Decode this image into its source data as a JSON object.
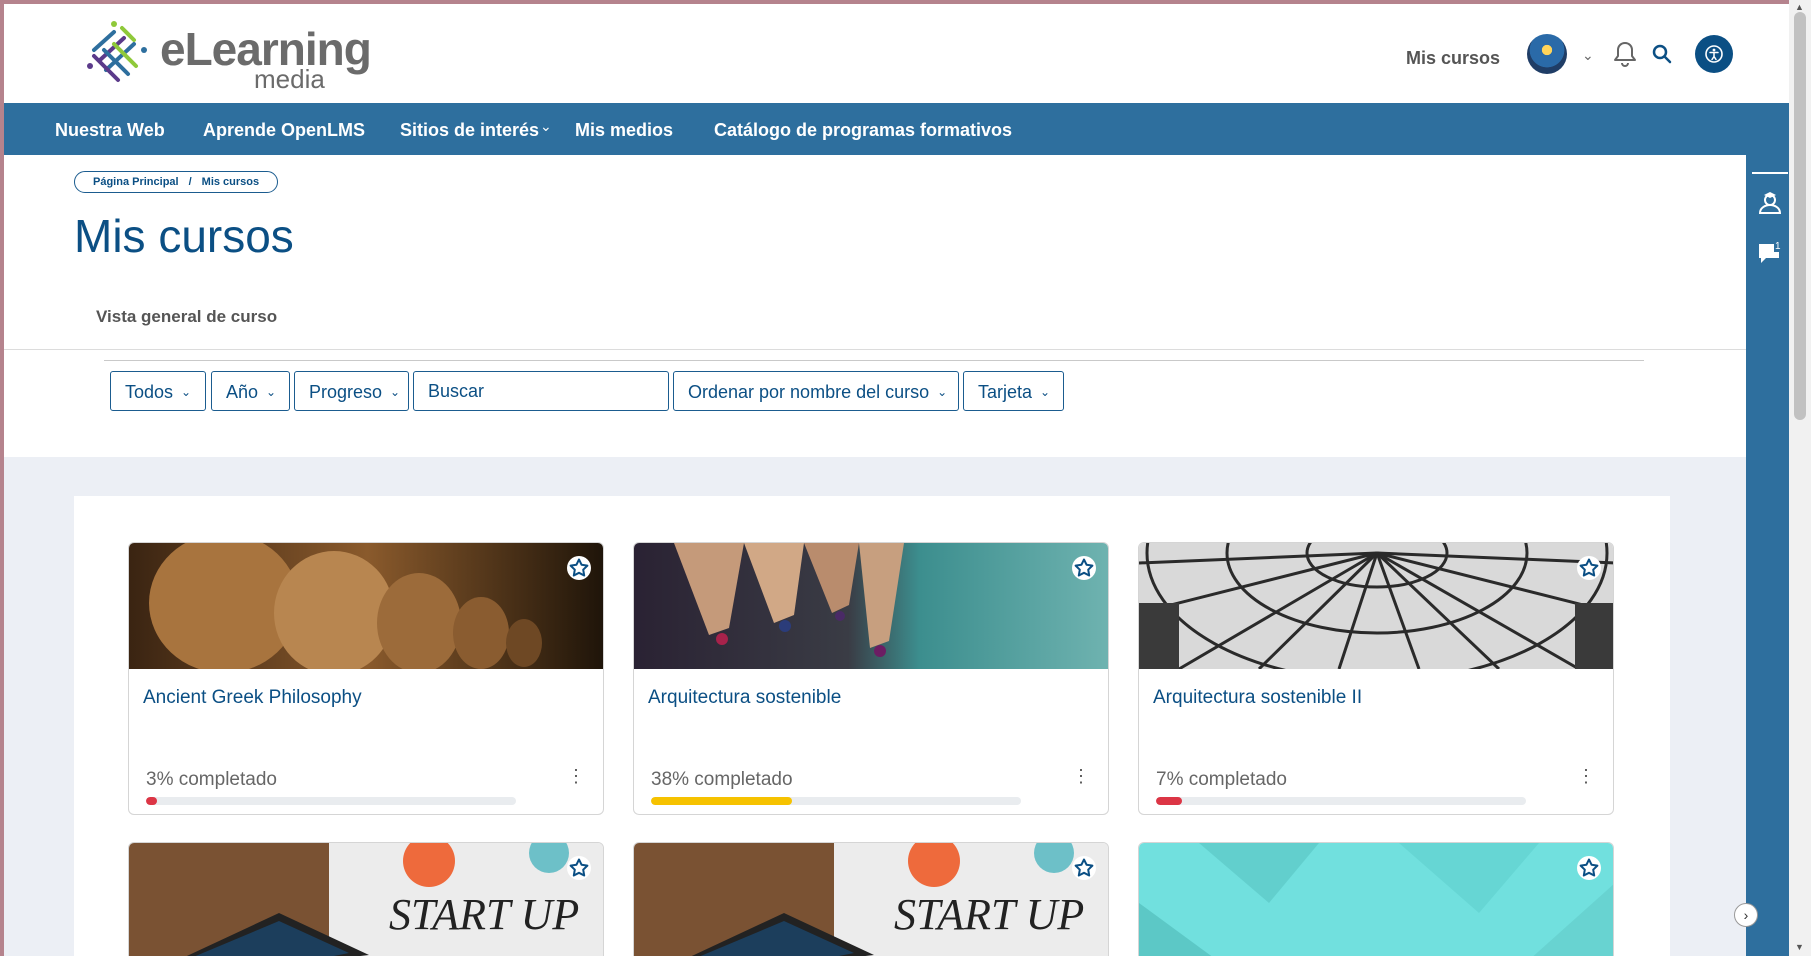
{
  "header": {
    "logo_text": "eLearning",
    "logo_sub": "media",
    "link": "Mis cursos",
    "icons": [
      "avatar",
      "chevron-down-icon",
      "bell-icon",
      "search-icon",
      "accessibility-icon"
    ]
  },
  "nav": {
    "items": [
      {
        "label": "Nuestra Web"
      },
      {
        "label": "Aprende OpenLMS"
      },
      {
        "label": "Sitios de interés"
      },
      {
        "label": "Mis medios"
      },
      {
        "label": "Catálogo de programas formativos"
      }
    ]
  },
  "breadcrumb": {
    "home": "Página Principal",
    "separator": "/",
    "current": "Mis cursos"
  },
  "page": {
    "title": "Mis cursos",
    "section": "Vista general de curso"
  },
  "filters": {
    "grouping": "Todos",
    "year": "Año",
    "progress": "Progreso",
    "search_placeholder": "Buscar",
    "sort": "Ordenar por nombre del curso",
    "view": "Tarjeta"
  },
  "courses": [
    {
      "title": "Ancient Greek Philosophy",
      "progress_label": "3% completado",
      "progress": 0.03,
      "color": "#dc3545"
    },
    {
      "title": "Arquitectura sostenible",
      "progress_label": "38% completado",
      "progress": 0.38,
      "color": "#f6c200"
    },
    {
      "title": "Arquitectura sostenible II",
      "progress_label": "7% completado",
      "progress": 0.07,
      "color": "#dc3545"
    },
    {
      "title": "",
      "image_text": "START UP"
    },
    {
      "title": "",
      "image_text": "START UP"
    },
    {
      "title": ""
    }
  ],
  "rail": {
    "messages_badge": "1"
  },
  "colors": {
    "primary": "#0b4f84",
    "navbar": "#2e6f9e",
    "grey_bg": "#eceff5"
  }
}
